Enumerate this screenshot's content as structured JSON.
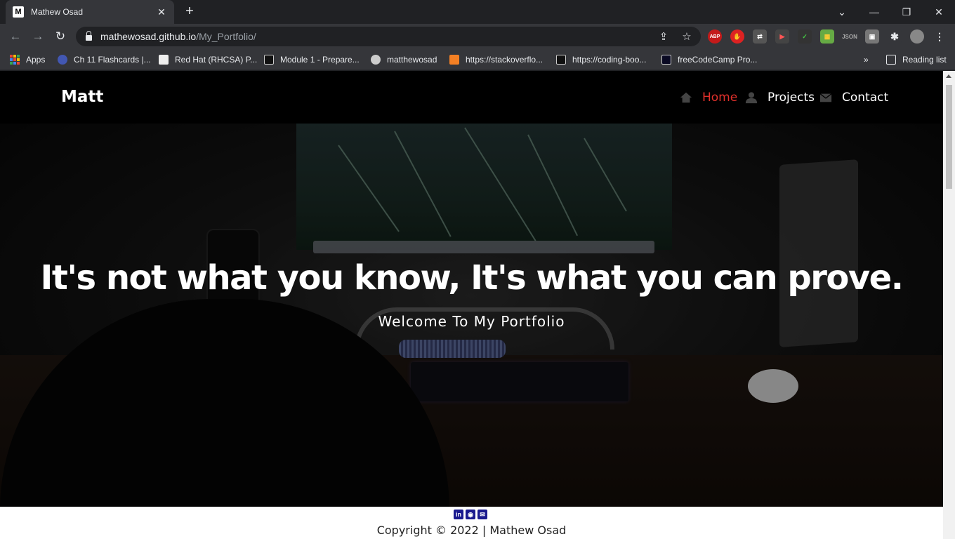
{
  "browser": {
    "tab_title": "Mathew Osad",
    "tab_favicon": "M",
    "new_tab": "+",
    "url_host": "mathewosad.github.io",
    "url_path": "/My_Portfolio/",
    "extensions": [
      "ABP",
      "JSON"
    ],
    "window_controls": [
      "⌄",
      "—",
      "❐",
      "✕"
    ]
  },
  "bookmarks": {
    "items": [
      {
        "label": "Apps",
        "icon": "apps-grid-icon"
      },
      {
        "label": "Ch 11 Flashcards |...",
        "icon": "quizlet-icon"
      },
      {
        "label": "Red Hat (RHCSA) P...",
        "icon": "page-icon"
      },
      {
        "label": "Module 1 - Prepare...",
        "icon": "book-icon"
      },
      {
        "label": "matthewosad",
        "icon": "github-icon"
      },
      {
        "label": "https://stackoverflo...",
        "icon": "stackoverflow-icon"
      },
      {
        "label": "https://coding-boo...",
        "icon": "book-icon"
      },
      {
        "label": "freeCodeCamp Pro...",
        "icon": "freecodecamp-icon"
      }
    ],
    "overflow": "»",
    "reading_list": "Reading list"
  },
  "site": {
    "brand": "Matt",
    "nav": [
      {
        "label": "Home",
        "icon": "home-icon",
        "active": true
      },
      {
        "label": "Projects",
        "icon": "user-icon",
        "active": false
      },
      {
        "label": "Contact",
        "icon": "envelope-icon",
        "active": false
      }
    ],
    "headline": "It's not what you know, It's what you can prove.",
    "subline": "Welcome To My Portfolio",
    "footer": {
      "social": [
        "linkedin-icon",
        "github-icon",
        "email-icon"
      ],
      "copyright": "Copyright © 2022 | Mathew Osad"
    }
  },
  "colors": {
    "accent_active": "#e0302b",
    "chrome_dark": "#202124",
    "chrome_toolbar": "#35363a",
    "social_blue": "#1a1a8f"
  }
}
